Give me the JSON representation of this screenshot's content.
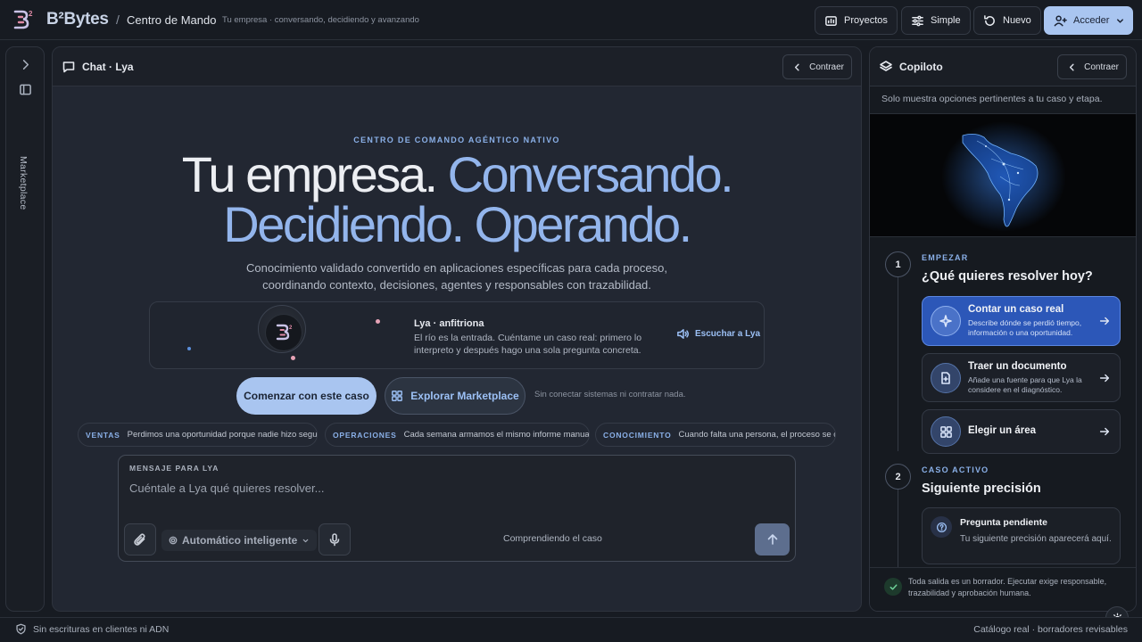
{
  "header": {
    "brand": "B²Bytes",
    "separator": "/",
    "breadcrumb": "Centro de Mando",
    "tagline": "Tu empresa · conversando, decidiendo y avanzando",
    "buttons": {
      "projects": "Proyectos",
      "simple": "Simple",
      "new": "Nuevo",
      "login": "Acceder"
    }
  },
  "rail": {
    "label": "Marketplace"
  },
  "chat": {
    "title": "Chat · Lya",
    "collapse": "Contraer",
    "eyebrow": "CENTRO DE COMANDO AGÉNTICO NATIVO",
    "hero_line1_white": "Tu empresa.",
    "hero_line1_blue": "Conversando.",
    "hero_line2_blue": "Decidiendo. Operando.",
    "subtitle_line1": "Conocimiento validado convertido en aplicaciones específicas para cada proceso,",
    "subtitle_line2": "coordinando contexto, decisiones, agentes y responsables con trazabilidad.",
    "host": {
      "name": "Lya · anfitriona",
      "text": "El río es la entrada. Cuéntame un caso real: primero lo interpreto y después hago una sola pregunta concreta.",
      "listen": "Escuchar a Lya"
    },
    "cta_primary": "Comenzar con este caso",
    "cta_secondary": "Explorar Marketplace",
    "cta_note": "Sin conectar sistemas ni contratar nada.",
    "chips": [
      {
        "category": "VENTAS",
        "text": "Perdimos una oportunidad porque nadie hizo seguim..."
      },
      {
        "category": "OPERACIONES",
        "text": "Cada semana armamos el mismo informe manual..."
      },
      {
        "category": "CONOCIMIENTO",
        "text": "Cuando falta una persona, el proceso se de..."
      }
    ],
    "composer": {
      "label": "MENSAJE PARA LYA",
      "placeholder": "Cuéntale a Lya qué quieres resolver...",
      "mode": "Automático inteligente",
      "status": "Comprendiendo el caso"
    }
  },
  "copilot": {
    "title": "Copiloto",
    "collapse": "Contraer",
    "note": "Solo muestra opciones pertinentes a tu caso y etapa.",
    "step1": {
      "number": "1",
      "eyebrow": "EMPEZAR",
      "title": "¿Qué quieres resolver hoy?",
      "options": [
        {
          "title": "Contar un caso real",
          "desc": "Describe dónde se perdió tiempo, información o una oportunidad."
        },
        {
          "title": "Traer un documento",
          "desc": "Añade una fuente para que Lya la considere en el diagnóstico."
        },
        {
          "title": "Elegir un área",
          "desc": ""
        }
      ]
    },
    "step2": {
      "number": "2",
      "eyebrow": "CASO ACTIVO",
      "title": "Siguiente precisión",
      "pending_title": "Pregunta pendiente",
      "pending_text": "Tu siguiente precisión aparecerá aquí."
    },
    "footer": "Toda salida es un borrador. Ejecutar exige responsable, trazabilidad y aprobación humana."
  },
  "statusbar": {
    "left": "Sin escrituras en clientes ni ADN",
    "right": "Catálogo real · borradores revisables"
  },
  "colors": {
    "accent": "#a9c5f0",
    "hero_blue": "#93b5ec",
    "active_option": "#2c57b8",
    "background": "#171b22"
  }
}
